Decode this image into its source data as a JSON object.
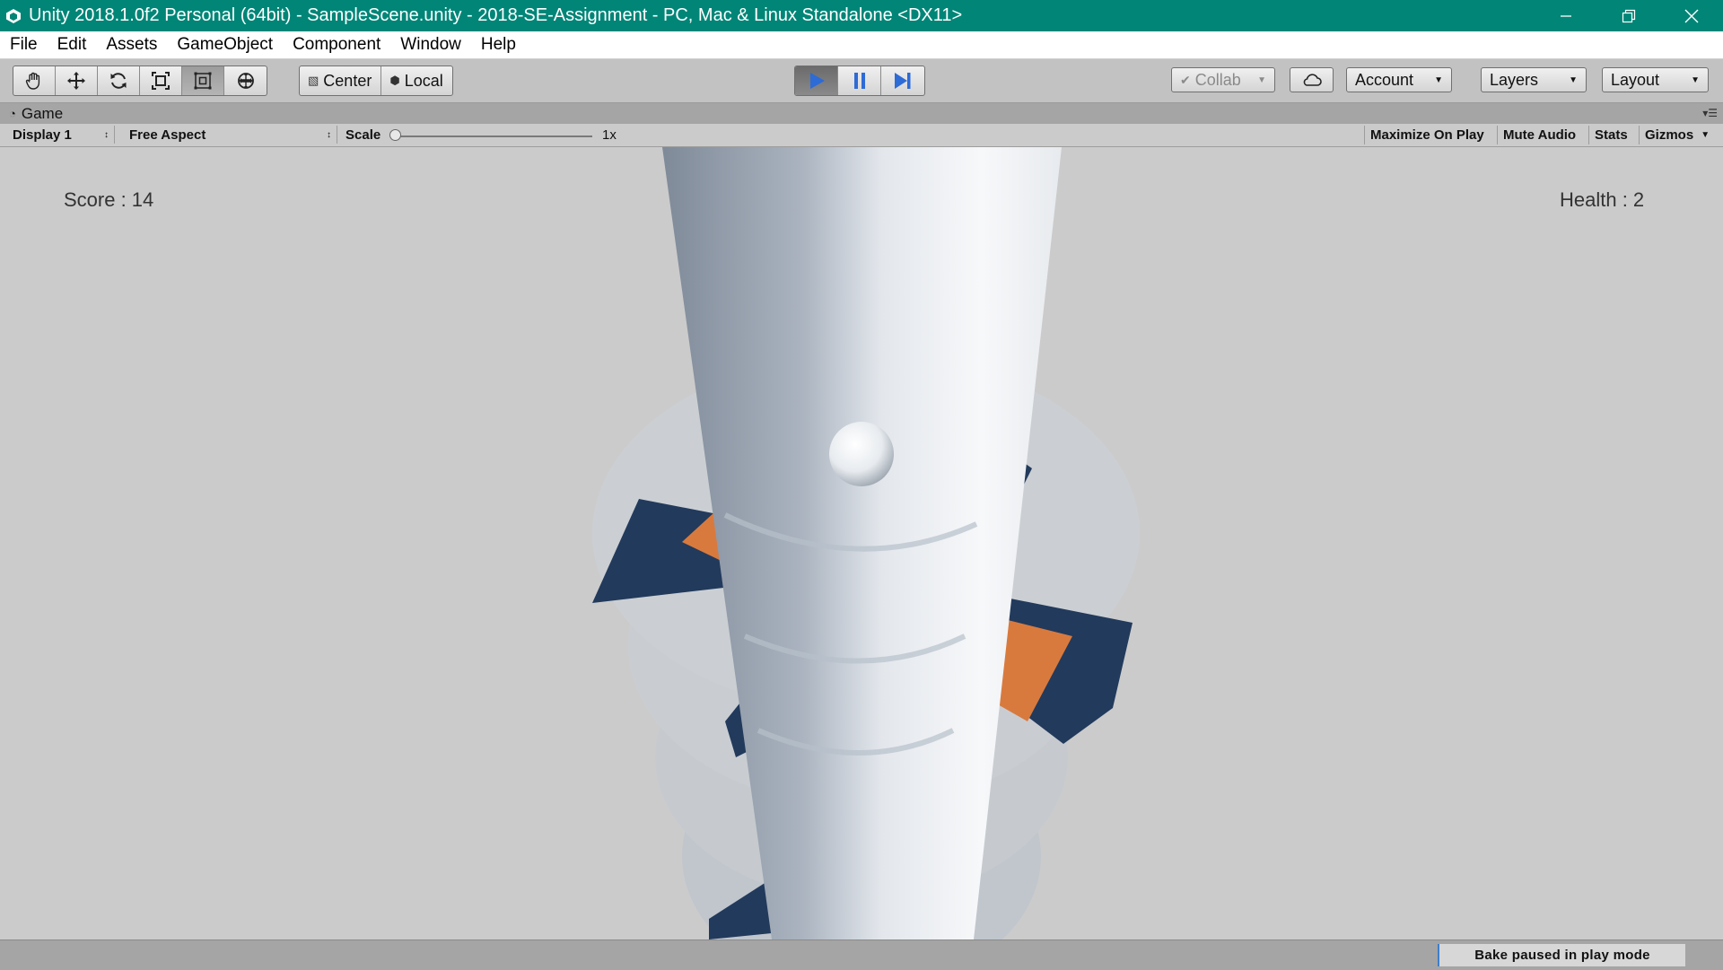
{
  "window": {
    "title": "Unity 2018.1.0f2 Personal (64bit) - SampleScene.unity - 2018-SE-Assignment - PC, Mac & Linux Standalone <DX11>",
    "title_bar_color": "#008577"
  },
  "menu": [
    "File",
    "Edit",
    "Assets",
    "GameObject",
    "Component",
    "Window",
    "Help"
  ],
  "toolbar": {
    "tools": [
      {
        "icon": "hand-icon",
        "active": false
      },
      {
        "icon": "move-icon",
        "active": false
      },
      {
        "icon": "rotate-icon",
        "active": false
      },
      {
        "icon": "scale-icon",
        "active": false
      },
      {
        "icon": "rect-transform-icon",
        "active": true
      },
      {
        "icon": "transform-icon",
        "active": false
      }
    ],
    "pivot": "Center",
    "space": "Local",
    "play_state": "playing",
    "collab": "Collab",
    "account": "Account",
    "layers": "Layers",
    "layout": "Layout",
    "accent_color": "#2d6bd6"
  },
  "game_tab": {
    "label": "Game",
    "display": "Display 1",
    "aspect": "Free Aspect",
    "scale_label": "Scale",
    "scale_value": "1x",
    "maximize_on_play": "Maximize On Play",
    "mute_audio": "Mute Audio",
    "stats": "Stats",
    "gizmos": "Gizmos"
  },
  "hud": {
    "score": "Score : 14",
    "health": "Health : 2"
  },
  "status": {
    "message": "Bake paused in play mode"
  },
  "scene_colors": {
    "background": "#cbcbcb",
    "safe_platform": "#223a5c",
    "danger_platform": "#d87a3e",
    "tower": "#d6dbe2"
  }
}
